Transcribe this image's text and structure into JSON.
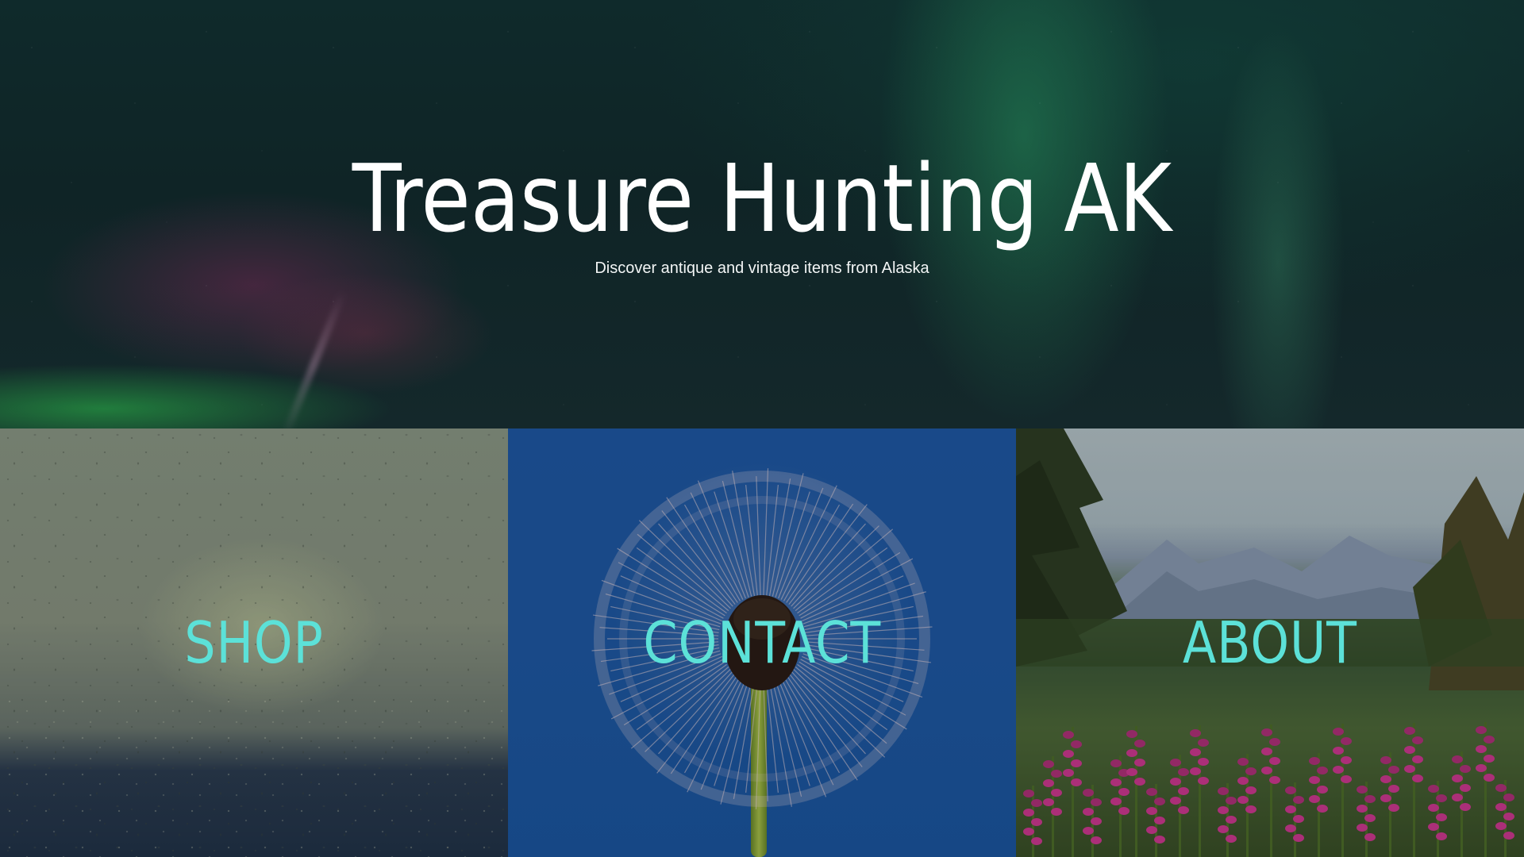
{
  "hero": {
    "title": "Treasure Hunting AK",
    "subtitle": "Discover antique and vintage items from Alaska"
  },
  "tiles": [
    {
      "label": "SHOP"
    },
    {
      "label": "CONTACT"
    },
    {
      "label": "ABOUT"
    }
  ],
  "colors": {
    "tile_label": "#5ce1d8",
    "hero_text": "#ffffff"
  }
}
